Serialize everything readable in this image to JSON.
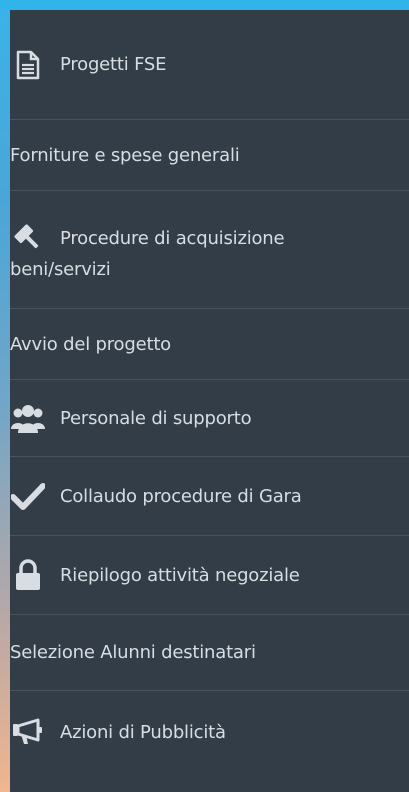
{
  "menu": {
    "items": [
      {
        "label": "Progetti FSE",
        "icon": "document-icon"
      },
      {
        "label": "Forniture e spese generali",
        "icon": ""
      },
      {
        "label_line1": "Procedure di acquisizione",
        "label_line2": "beni/servizi",
        "icon": "gavel-icon"
      },
      {
        "label": "Avvio del progetto",
        "icon": ""
      },
      {
        "label": "Personale di supporto",
        "icon": "users-icon"
      },
      {
        "label": "Collaudo procedure di Gara",
        "icon": "check-icon"
      },
      {
        "label": "Riepilogo attività negoziale",
        "icon": "lock-icon"
      },
      {
        "label": "Selezione Alunni destinatari",
        "icon": ""
      },
      {
        "label": "Azioni di Pubblicità",
        "icon": "megaphone-icon"
      }
    ]
  },
  "colors": {
    "sidebar_bg": "#333d47",
    "divider": "#475260",
    "text": "#d7dde3",
    "top_bar": "#31b4ea"
  }
}
